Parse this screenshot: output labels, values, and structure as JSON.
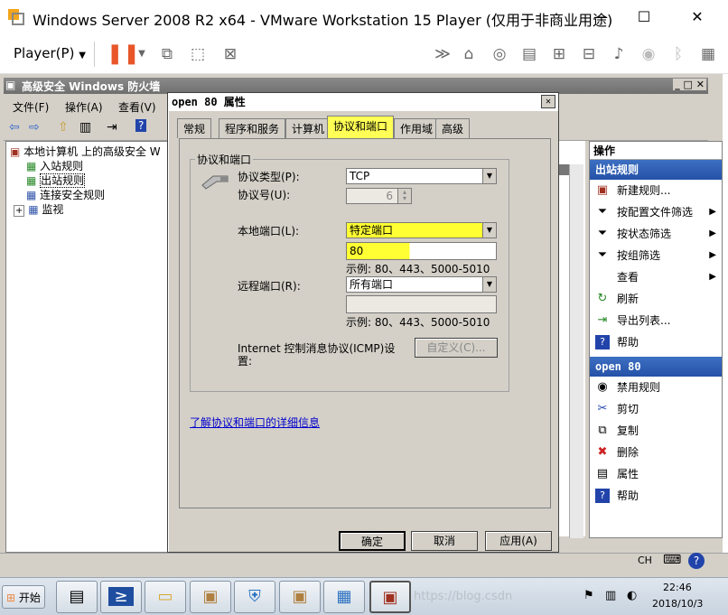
{
  "host": {
    "title": "Windows Server 2008 R2 x64 - VMware Workstation 15 Player (仅用于非商业用途)",
    "player_menu": "Player(P)",
    "minimize": "—",
    "maximize": "☐",
    "close": "✕"
  },
  "mmc": {
    "title": "高级安全 Windows 防火墙",
    "menu": [
      "文件(F)",
      "操作(A)",
      "查看(V)"
    ],
    "tree": {
      "root": "本地计算机 上的高级安全 W",
      "items": [
        "入站规则",
        "出站规则",
        "连接安全规则",
        "监视"
      ]
    },
    "actions": {
      "header": "操作",
      "section1_title": "出站规则",
      "section1_items": [
        "新建规则...",
        "按配置文件筛选",
        "按状态筛选",
        "按组筛选",
        "查看",
        "刷新",
        "导出列表...",
        "帮助"
      ],
      "section2_title": "open 80",
      "section2_items": [
        "禁用规则",
        "剪切",
        "复制",
        "删除",
        "属性",
        "帮助"
      ]
    }
  },
  "dialog": {
    "title": "open 80 属性",
    "close": "✕",
    "tabs": [
      "常规",
      "程序和服务",
      "计算机",
      "协议和端口",
      "作用域",
      "高级"
    ],
    "group_title": "协议和端口",
    "protocol_type_label": "协议类型(P):",
    "protocol_type_value": "TCP",
    "protocol_number_label": "协议号(U):",
    "protocol_number_value": "6",
    "local_port_label": "本地端口(L):",
    "local_port_value": "特定端口",
    "local_port_input": "80",
    "example1": "示例: 80、443、5000-5010",
    "remote_port_label": "远程端口(R):",
    "remote_port_value": "所有端口",
    "example2": "示例: 80、443、5000-5010",
    "icmp_label_1": "Internet 控制消息协议(ICMP)设",
    "icmp_label_2": "置:",
    "customize_button": "自定义(C)...",
    "learn_link": "了解协议和端口的详细信息",
    "ok_button": "确定",
    "cancel_button": "取消",
    "apply_button": "应用(A)"
  },
  "taskbar": {
    "start": "开始",
    "lang": "CH",
    "time": "22:46",
    "date": "2018/10/3",
    "watermark": "https://blog.csdn"
  }
}
